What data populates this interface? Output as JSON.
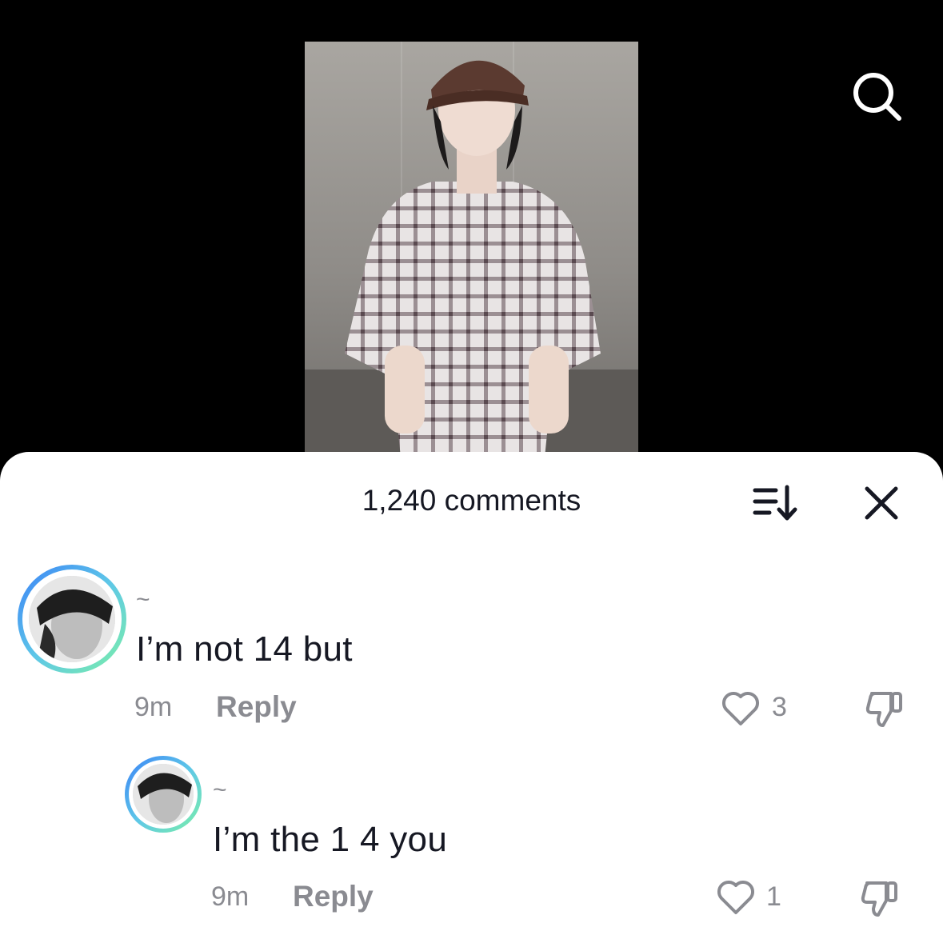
{
  "header": {
    "comment_count": "1,240 comments",
    "icons": {
      "search": "search-icon",
      "sort": "sort-icon",
      "close": "close-icon"
    }
  },
  "comments": [
    {
      "username": "~",
      "text": "I’m not 14 but",
      "time": "9m",
      "reply_label": "Reply",
      "like_count": "3"
    },
    {
      "username": "~",
      "text": "I’m the 1 4 you",
      "time": "9m",
      "reply_label": "Reply",
      "like_count": "1"
    }
  ],
  "colors": {
    "background": "#000000",
    "sheet": "#ffffff",
    "primary_text": "#161823",
    "secondary_text": "#8a8b91",
    "avatar_ring_start": "#3b82f6",
    "avatar_ring_end": "#7cf0a6"
  }
}
